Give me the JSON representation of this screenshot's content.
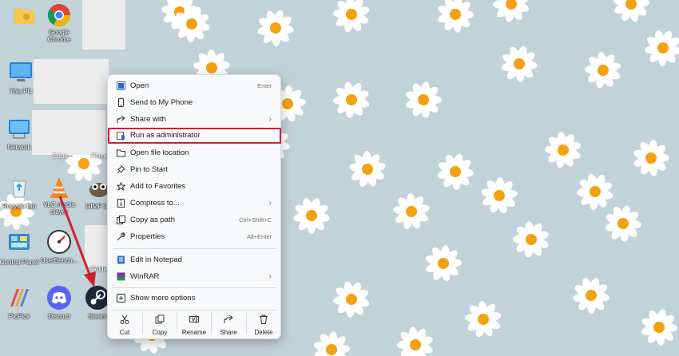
{
  "desktop": {
    "icons": [
      {
        "label": ""
      },
      {
        "label": "Google Chrome"
      },
      {
        "label": "This PC"
      },
      {
        "label": "Network"
      },
      {
        "label": "Recycle Bin"
      },
      {
        "label": "VLC media player"
      },
      {
        "label": "GIMP 3..."
      },
      {
        "label": "Control Panel"
      },
      {
        "label": "UserBench..."
      },
      {
        "label": "PicPick"
      },
      {
        "label": "Discord"
      },
      {
        "label": "Steam"
      }
    ],
    "partial_labels": {
      "edge": "Edge",
      "player": "Player",
      "folder": "Folder"
    }
  },
  "context_menu": {
    "items": [
      {
        "label": "Open",
        "shortcut": "Enter"
      },
      {
        "label": "Send to My Phone"
      },
      {
        "label": "Share with"
      },
      {
        "label": "Run as administrator"
      },
      {
        "label": "Open file location"
      },
      {
        "label": "Pin to Start"
      },
      {
        "label": "Add to Favorites"
      },
      {
        "label": "Compress to..."
      },
      {
        "label": "Copy as path",
        "shortcut": "Ctrl+Shift+C"
      },
      {
        "label": "Properties",
        "shortcut": "Alt+Enter"
      },
      {
        "label": "Edit in Notepad"
      },
      {
        "label": "WinRAR"
      },
      {
        "label": "Show more options"
      }
    ],
    "chevron": "›",
    "actions": [
      {
        "label": "Cut"
      },
      {
        "label": "Copy"
      },
      {
        "label": "Rename"
      },
      {
        "label": "Share"
      },
      {
        "label": "Delete"
      }
    ]
  },
  "colors": {
    "wallpaper": "#c2d2d9",
    "highlight_border": "#d0202f",
    "arrow": "#d0202f",
    "daisy_petal": "#ffffff",
    "daisy_center": "#f4a10f"
  }
}
